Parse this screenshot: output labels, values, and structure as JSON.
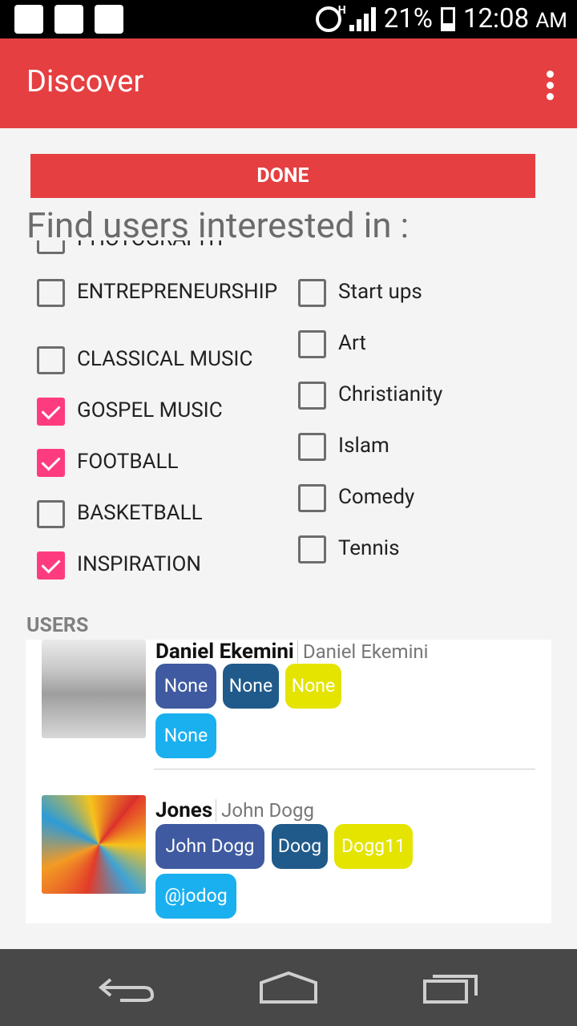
{
  "status_bar": {
    "battery": "21%",
    "time": "12:08",
    "ampm": "AM",
    "network": "H"
  },
  "app_bar": {
    "title": "Discover"
  },
  "done_label": "DONE",
  "find_title": "Find users interested in :",
  "interests_left": [
    {
      "label": "PHOTOGRAPHY",
      "checked": false
    },
    {
      "label": "ENTREPRENEURSHIP",
      "checked": false
    },
    {
      "label": "CLASSICAL MUSIC",
      "checked": false
    },
    {
      "label": "GOSPEL MUSIC",
      "checked": true
    },
    {
      "label": "FOOTBALL",
      "checked": true
    },
    {
      "label": "BASKETBALL",
      "checked": false
    },
    {
      "label": "INSPIRATION",
      "checked": true
    }
  ],
  "interests_right": [
    {
      "label": "Start ups",
      "checked": false
    },
    {
      "label": "Art",
      "checked": false
    },
    {
      "label": "Christianity",
      "checked": false
    },
    {
      "label": "Islam",
      "checked": false
    },
    {
      "label": "Comedy",
      "checked": false
    },
    {
      "label": "Tennis",
      "checked": false
    }
  ],
  "users_label": "USERS",
  "users": [
    {
      "name": "Daniel Ekemini",
      "handle": "Daniel Ekemini",
      "chips": [
        {
          "text": "None",
          "color": "#3f5aa0"
        },
        {
          "text": "None",
          "color": "#1f5a8a"
        },
        {
          "text": "None",
          "color": "#e4e400"
        },
        {
          "text": "None",
          "color": "#1ab0ef"
        }
      ]
    },
    {
      "name": "Jones",
      "handle": "John Dogg",
      "chips": [
        {
          "text": "John Dogg",
          "color": "#3f5aa0"
        },
        {
          "text": "Doog",
          "color": "#1f5a8a"
        },
        {
          "text": "Dogg11",
          "color": "#e4e400"
        },
        {
          "text": "@jodog",
          "color": "#1ab0ef"
        }
      ]
    }
  ],
  "colors": {
    "accent": "#e53f41",
    "checkbox": "#ff3b7f"
  }
}
